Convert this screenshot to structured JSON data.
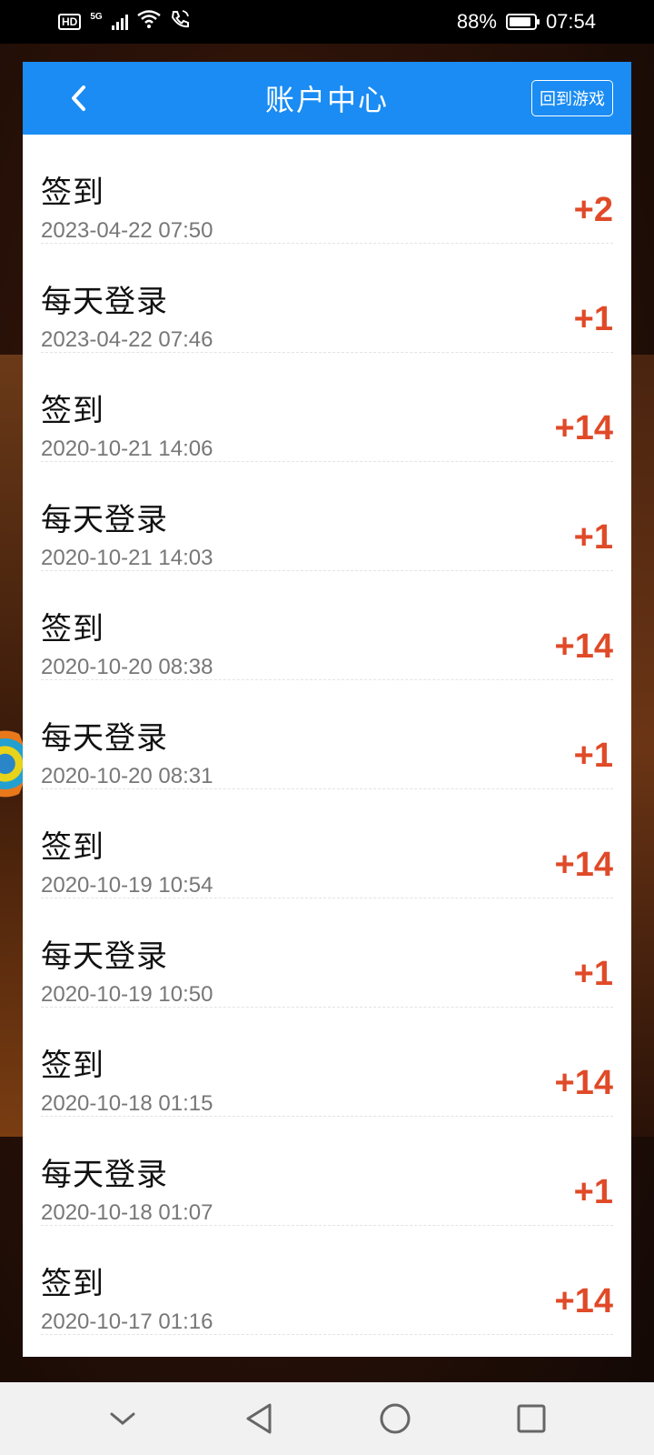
{
  "status_bar": {
    "hd": "HD",
    "network": "5G",
    "battery": "88%",
    "battery_level": 0.88,
    "time": "07:54"
  },
  "header": {
    "title": "账户中心",
    "return_label": "回到游戏"
  },
  "records": [
    {
      "title": "签到",
      "time": "2023-04-22 07:50",
      "points": "+2"
    },
    {
      "title": "每天登录",
      "time": "2023-04-22 07:46",
      "points": "+1"
    },
    {
      "title": "签到",
      "time": "2020-10-21 14:06",
      "points": "+14"
    },
    {
      "title": "每天登录",
      "time": "2020-10-21 14:03",
      "points": "+1"
    },
    {
      "title": "签到",
      "time": "2020-10-20 08:38",
      "points": "+14"
    },
    {
      "title": "每天登录",
      "time": "2020-10-20 08:31",
      "points": "+1"
    },
    {
      "title": "签到",
      "time": "2020-10-19 10:54",
      "points": "+14"
    },
    {
      "title": "每天登录",
      "time": "2020-10-19 10:50",
      "points": "+1"
    },
    {
      "title": "签到",
      "time": "2020-10-18 01:15",
      "points": "+14"
    },
    {
      "title": "每天登录",
      "time": "2020-10-18 01:07",
      "points": "+1"
    },
    {
      "title": "签到",
      "time": "2020-10-17 01:16",
      "points": "+14"
    }
  ],
  "colors": {
    "header_bg": "#1a8cf3",
    "points": "#e04a28"
  }
}
